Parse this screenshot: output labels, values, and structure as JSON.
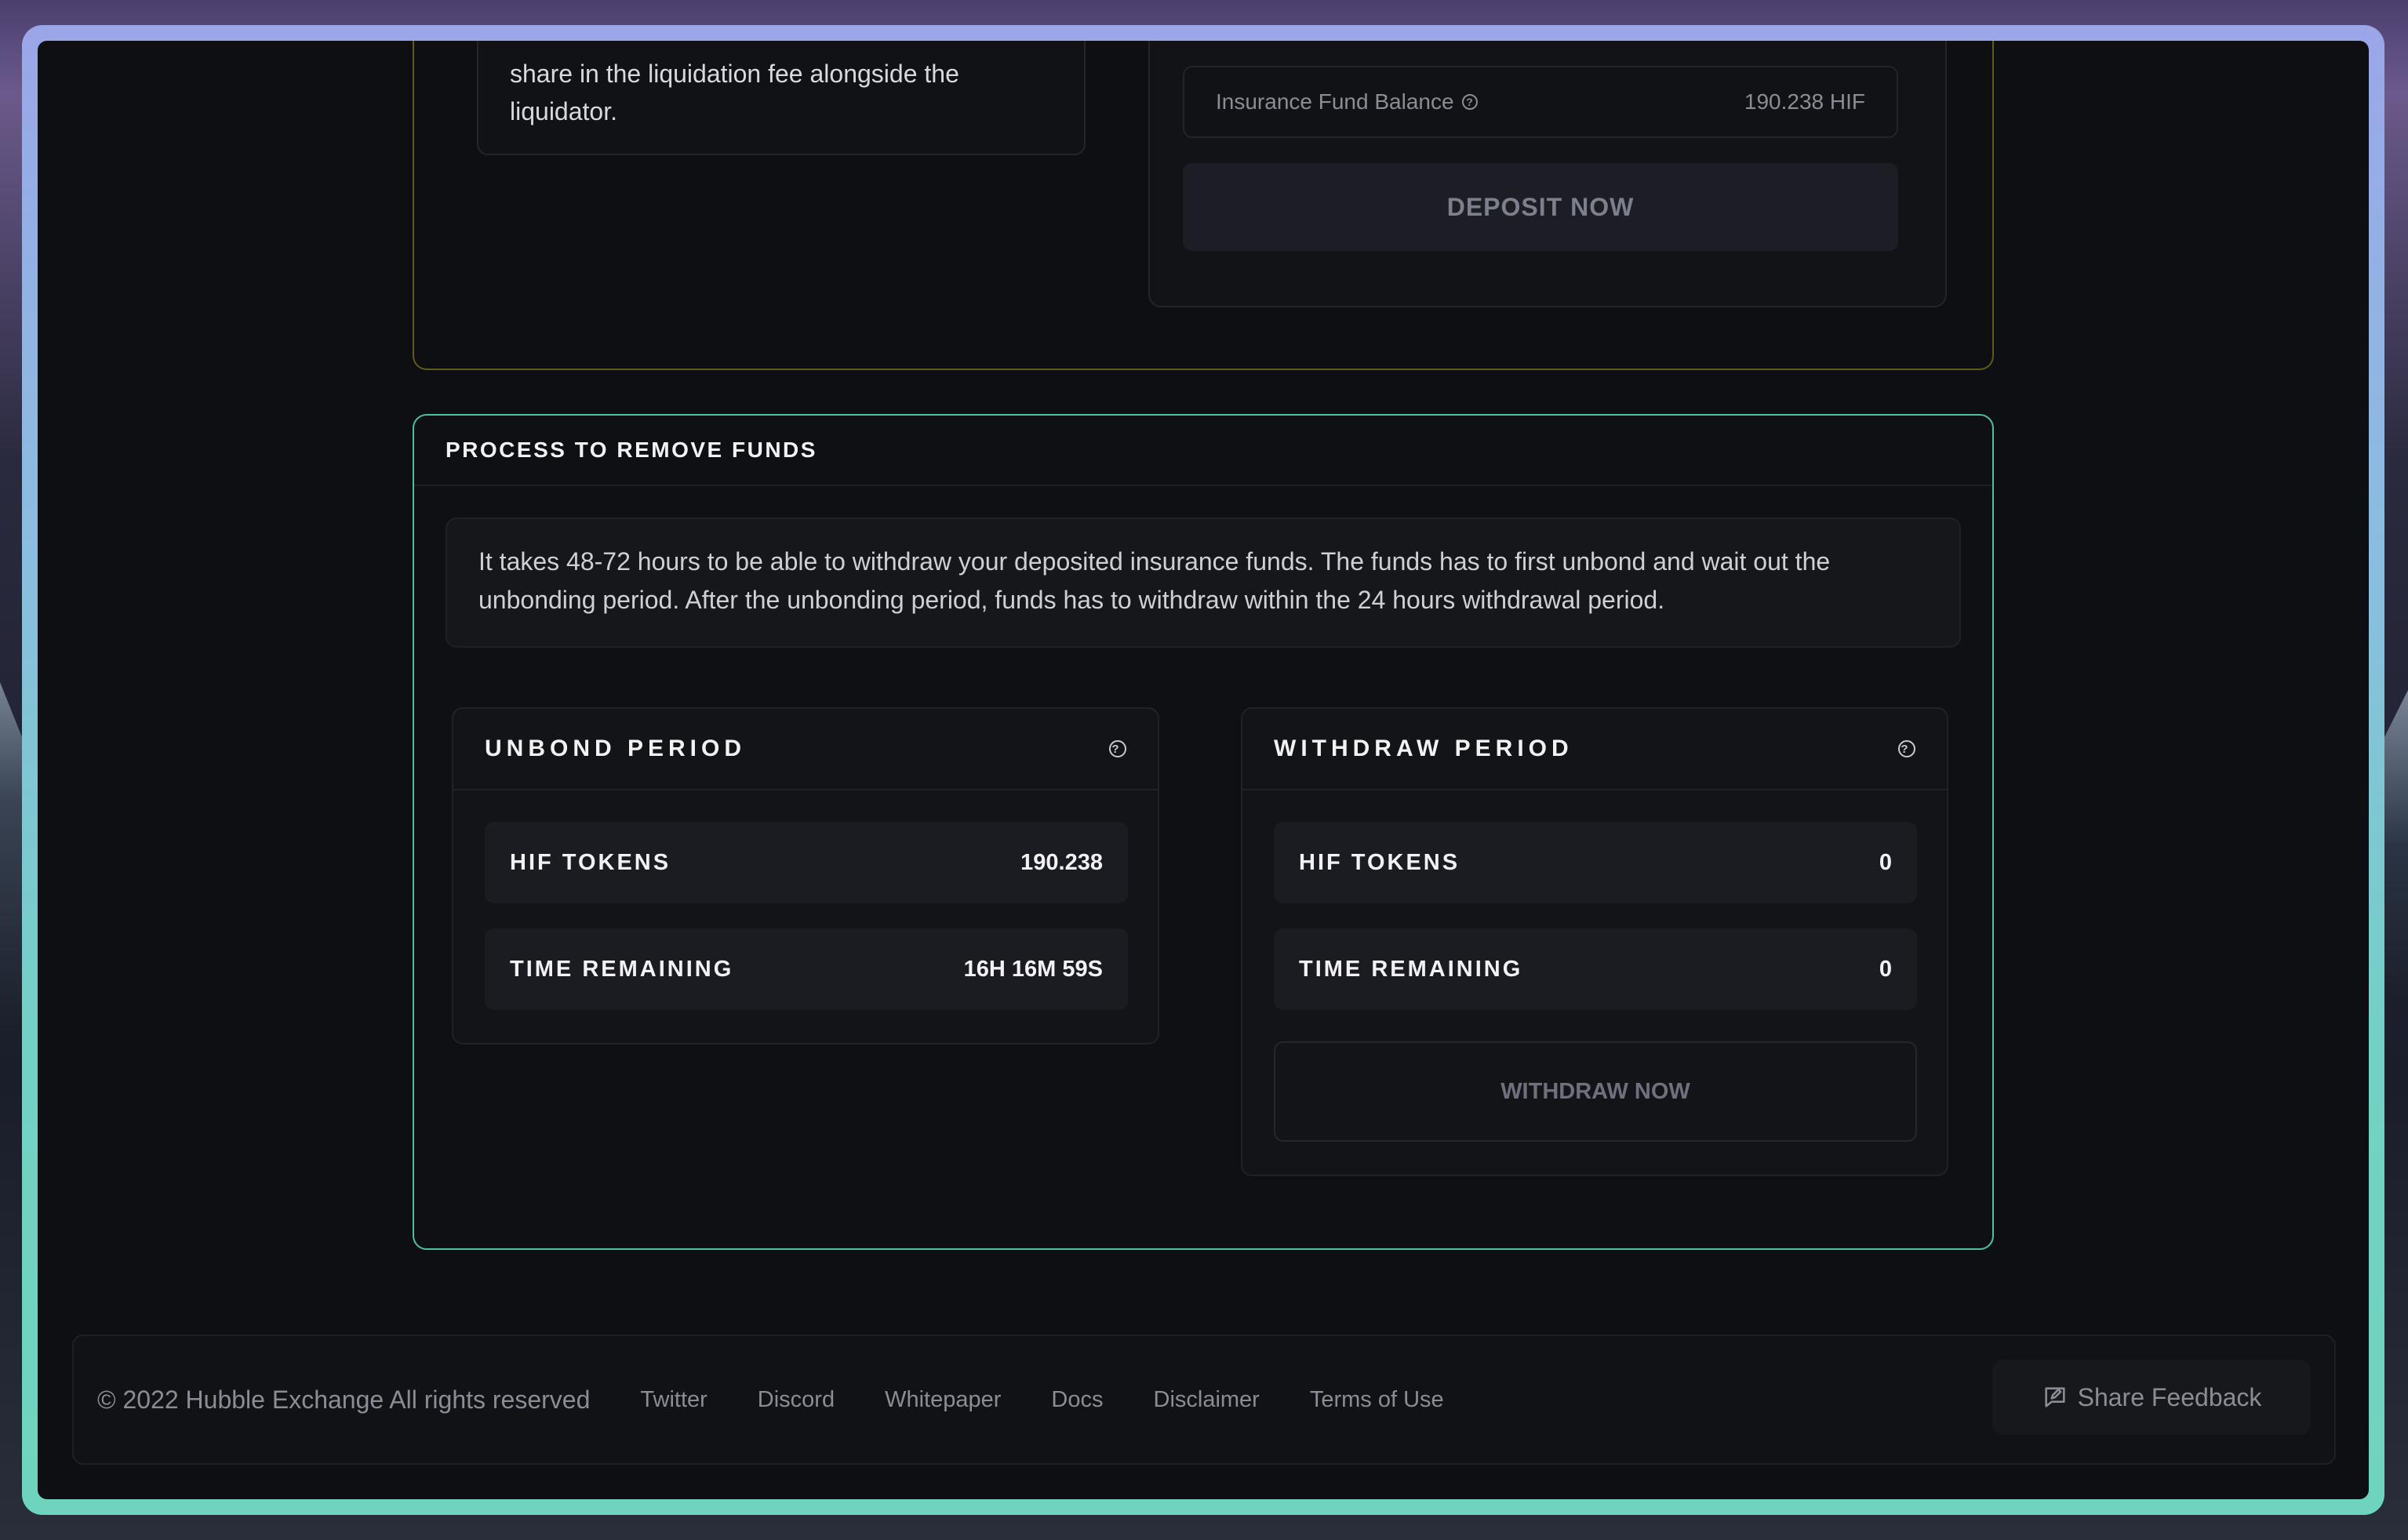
{
  "liquidation_card": {
    "text": "share in the liquidation fee alongside the liquidator."
  },
  "deposit_panel": {
    "balance_label": "Insurance Fund Balance",
    "balance_value": "190.238 HIF",
    "deposit_button": "DEPOSIT NOW"
  },
  "process": {
    "title": "PROCESS TO REMOVE FUNDS",
    "info": "It takes 48-72 hours to be able to withdraw your deposited insurance funds. The funds has to first unbond and wait out the unbonding period. After the unbonding period, funds has to withdraw within the 24 hours withdrawal period.",
    "unbond": {
      "title": "UNBOND PERIOD",
      "tokens_label": "HIF TOKENS",
      "tokens_value": "190.238",
      "time_label": "TIME REMAINING",
      "time_value": "16H 16M 59S"
    },
    "withdraw": {
      "title": "WITHDRAW PERIOD",
      "tokens_label": "HIF TOKENS",
      "tokens_value": "0",
      "time_label": "TIME REMAINING",
      "time_value": "0",
      "button": "WITHDRAW NOW"
    }
  },
  "footer": {
    "copyright": "© 2022 Hubble Exchange All rights reserved",
    "links": [
      "Twitter",
      "Discord",
      "Whitepaper",
      "Docs",
      "Disclaimer",
      "Terms of Use"
    ],
    "feedback": "Share Feedback"
  },
  "icons": {
    "help": "question-circle-icon",
    "feedback": "chat-edit-icon"
  },
  "colors": {
    "process_border": "#4fbf9e",
    "top_card_border": "#5f5a1e",
    "background": "#0e0f12"
  }
}
